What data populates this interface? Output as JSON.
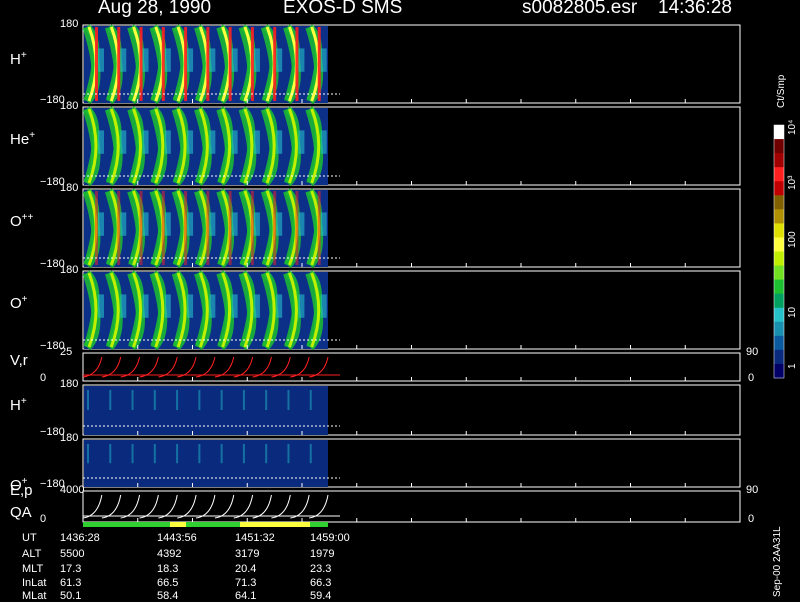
{
  "header": {
    "date": "Aug 28, 1990",
    "instrument": "EXOS-D SMS",
    "file": "s0082805.esr",
    "time": "14:36:28"
  },
  "side": {
    "colorbar_units": "Ct/Smp",
    "footer_code": "Sep-00 2AA31L"
  },
  "colors": {
    "background": "#000000",
    "spectrogram_floor": "#0a2a7e",
    "velocity_trace": "#ff2020",
    "quality_good": "#2fd02f",
    "quality_warn": "#ffff40"
  },
  "chart_data": [
    {
      "type": "heatmap",
      "panel": "H+",
      "label_base": "H",
      "label_sup": "+",
      "ylim": [
        -180,
        180
      ],
      "ytick_top": "180",
      "ytick_bottom": "−180"
    },
    {
      "type": "heatmap",
      "panel": "He+",
      "label_base": "He",
      "label_sup": "+",
      "ylim": [
        -180,
        180
      ],
      "ytick_top": "180",
      "ytick_bottom": "−180"
    },
    {
      "type": "heatmap",
      "panel": "O++",
      "label_base": "O",
      "label_sup": "++",
      "ylim": [
        -180,
        180
      ],
      "ytick_top": "180",
      "ytick_bottom": "−180"
    },
    {
      "type": "heatmap",
      "panel": "O+",
      "label_base": "O",
      "label_sup": "+",
      "ylim": [
        -180,
        180
      ],
      "ytick_top": "180",
      "ytick_bottom": "−180"
    },
    {
      "type": "line",
      "panel": "V,r",
      "label_base": "V,r",
      "ylim": [
        0,
        25
      ],
      "ytick_top": "25",
      "ytick_bottom": "0",
      "right_top": "90",
      "right_bottom": "0"
    },
    {
      "type": "heatmap",
      "panel": "H+ (lower)",
      "label_base": "H",
      "label_sup": "+",
      "ylim": [
        -180,
        180
      ],
      "ytick_top": "180",
      "ytick_bottom": "−180"
    },
    {
      "type": "heatmap",
      "panel": "O+ (lower)",
      "label_base": "O",
      "label_sup": "+",
      "ylim": [
        -180,
        180
      ],
      "ytick_top": "180",
      "ytick_bottom": "−180"
    },
    {
      "type": "line",
      "panel": "E,p",
      "label_base": "E,p",
      "label2": "QA",
      "ylim": [
        0,
        4000
      ],
      "ytick_top": "4000",
      "ytick_bottom": "0",
      "right_top": "90",
      "right_bottom": "0"
    }
  ],
  "colorbar": {
    "ticks": [
      "1",
      "10",
      "100",
      "10³",
      "10⁴"
    ],
    "colors": [
      "#000066",
      "#0a2a7e",
      "#0a5aa0",
      "#1a90b0",
      "#25c0c8",
      "#00a060",
      "#1cc030",
      "#70e020",
      "#c0f000",
      "#ffff40",
      "#e0e000",
      "#b09000",
      "#806000",
      "#c00000",
      "#ff2020",
      "#a00000",
      "#700000",
      "#ffffff"
    ]
  },
  "ephemeris": {
    "labels": [
      "UT",
      "ALT",
      "MLT",
      "InLat",
      "MLat"
    ],
    "columns": [
      [
        "1436:28",
        "5500",
        "17.3",
        "61.3",
        "50.1"
      ],
      [
        "1443:56",
        "4392",
        "18.3",
        "66.5",
        "58.4"
      ],
      [
        "1451:32",
        "3179",
        "20.4",
        "71.3",
        "64.1"
      ],
      [
        "1459:00",
        "1979",
        "23.3",
        "66.3",
        "59.4"
      ]
    ]
  }
}
